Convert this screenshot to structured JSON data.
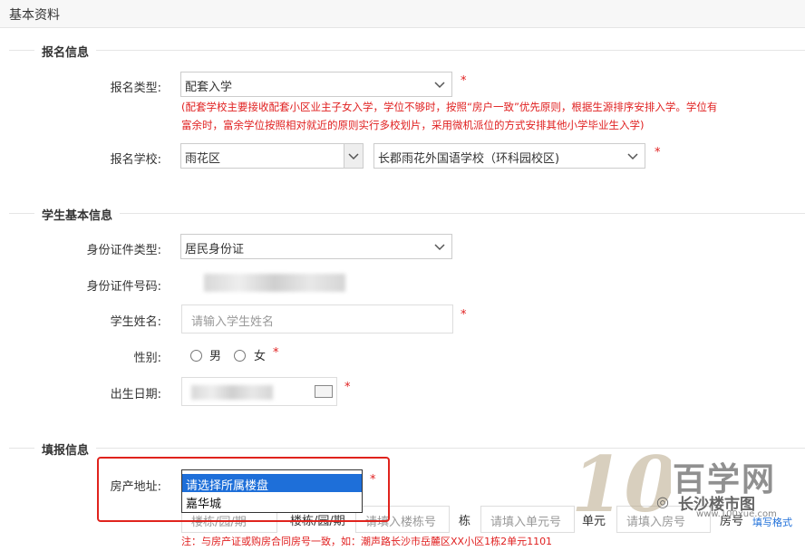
{
  "page": {
    "title": "基本资料"
  },
  "sections": {
    "enroll": "报名信息",
    "student": "学生基本信息",
    "fill": "填报信息"
  },
  "enroll": {
    "type_label": "报名类型:",
    "type_value": "配套入学",
    "note_line1": "(配套学校主要接收配套小区业主子女入学，学位不够时，按照“房户一致”优先原则，根据生源排序安排入学。学位有",
    "note_line2": "富余时，富余学位按照相对就近的原则实行多校划片，采用微机派位的方式安排其他小学毕业生入学)",
    "school_label": "报名学校:",
    "district_value": "雨花区",
    "school_value": "长郡雨花外国语学校（环科园校区)"
  },
  "student": {
    "id_type_label": "身份证件类型:",
    "id_type_value": "居民身份证",
    "id_no_label": "身份证件号码:",
    "name_label": "学生姓名:",
    "name_placeholder": "请输入学生姓名",
    "gender_label": "性别:",
    "gender_male": "男",
    "gender_female": "女",
    "birth_label": "出生日期:"
  },
  "fill": {
    "property_label": "房产地址:",
    "dropdown_options": [
      "请选择所属楼盘",
      "嘉华城"
    ],
    "sub_fields": [
      "楼栋/园/期",
      "楼栋/园/期"
    ],
    "building_placeholder": "请填入楼栋号",
    "building_unit": "栋",
    "unit_placeholder": "请填入单元号",
    "unit_unit": "单元",
    "room_placeholder": "请填入房号",
    "room_unit": "房号",
    "footer_note": "注：与房产证或购房合同房号一致，如：潮声路长沙市岳麓区XX小区1栋2单元1101"
  },
  "required_mark": "*",
  "watermark": {
    "brand_cn": "百学网",
    "brand_url": "www.100xue.com",
    "wechat_account": "长沙楼市图",
    "format_link": "填写格式"
  },
  "colors": {
    "accent": "#1e6fd9",
    "required": "#e02020",
    "highlight_box": "#e0231d"
  }
}
